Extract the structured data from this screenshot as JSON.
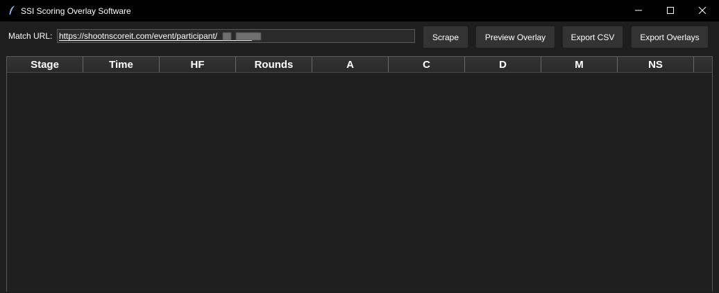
{
  "window": {
    "title": "SSI Scoring Overlay Software"
  },
  "toolbar": {
    "url_label": "Match URL:",
    "url_value": "https://shootnscoreit.com/event/participant/    /         /",
    "buttons": {
      "scrape": "Scrape",
      "preview": "Preview Overlay",
      "export_csv": "Export CSV",
      "export_overlays": "Export Overlays"
    }
  },
  "table": {
    "columns": [
      "Stage",
      "Time",
      "HF",
      "Rounds",
      "A",
      "C",
      "D",
      "M",
      "NS"
    ],
    "rows": []
  },
  "icons": {
    "app": "feather-icon",
    "minimize": "minimize-icon",
    "maximize": "maximize-icon",
    "close": "close-icon"
  },
  "colors": {
    "titlebar_bg": "#000000",
    "panel_bg": "#1e1e1e",
    "button_bg": "#333333",
    "text": "#ffffff"
  }
}
